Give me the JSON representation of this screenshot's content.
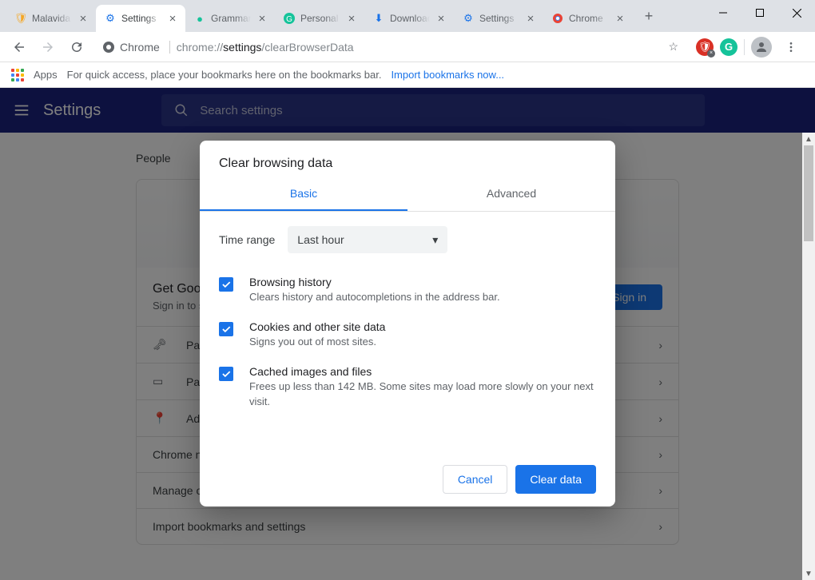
{
  "window": {
    "tabs": [
      {
        "title": "Malavida",
        "favicon_color": "#f5a623"
      },
      {
        "title": "Settings",
        "favicon_color": "#1a73e8"
      },
      {
        "title": "Grammarly",
        "favicon_color": "#15c39a"
      },
      {
        "title": "Personal",
        "favicon_color": "#15c39a"
      },
      {
        "title": "Downloads",
        "favicon_color": "#1a73e8"
      },
      {
        "title": "Settings",
        "favicon_color": "#1a73e8"
      },
      {
        "title": "Chrome",
        "favicon_color": "#ea4335"
      }
    ],
    "active_tab": 1
  },
  "omnibox": {
    "badge_label": "Chrome",
    "url_prefix": "chrome://",
    "url_bold": "settings",
    "url_suffix": "/clearBrowserData"
  },
  "bookmarks_bar": {
    "apps_label": "Apps",
    "hint_text": "For quick access, place your bookmarks here on the bookmarks bar.",
    "import_link": "Import bookmarks now..."
  },
  "settings": {
    "title": "Settings",
    "search_placeholder": "Search settings",
    "section": "People",
    "signin_title": "Get Google smarts in Chrome",
    "signin_sub": "Sign in to sync and personalize Chrome across your devices",
    "signin_button": "Sign in",
    "rows": [
      {
        "icon": "key",
        "label": "Passwords"
      },
      {
        "icon": "card",
        "label": "Payment methods"
      },
      {
        "icon": "pin",
        "label": "Addresses and more"
      }
    ],
    "plain_rows": [
      "Chrome name and picture",
      "Manage other people",
      "Import bookmarks and settings"
    ]
  },
  "modal": {
    "title": "Clear browsing data",
    "tabs": {
      "basic": "Basic",
      "advanced": "Advanced"
    },
    "time_range_label": "Time range",
    "time_range_value": "Last hour",
    "options": [
      {
        "title": "Browsing history",
        "desc": "Clears history and autocompletions in the address bar."
      },
      {
        "title": "Cookies and other site data",
        "desc": "Signs you out of most sites."
      },
      {
        "title": "Cached images and files",
        "desc": "Frees up less than 142 MB. Some sites may load more slowly on your next visit."
      }
    ],
    "cancel": "Cancel",
    "confirm": "Clear data"
  }
}
